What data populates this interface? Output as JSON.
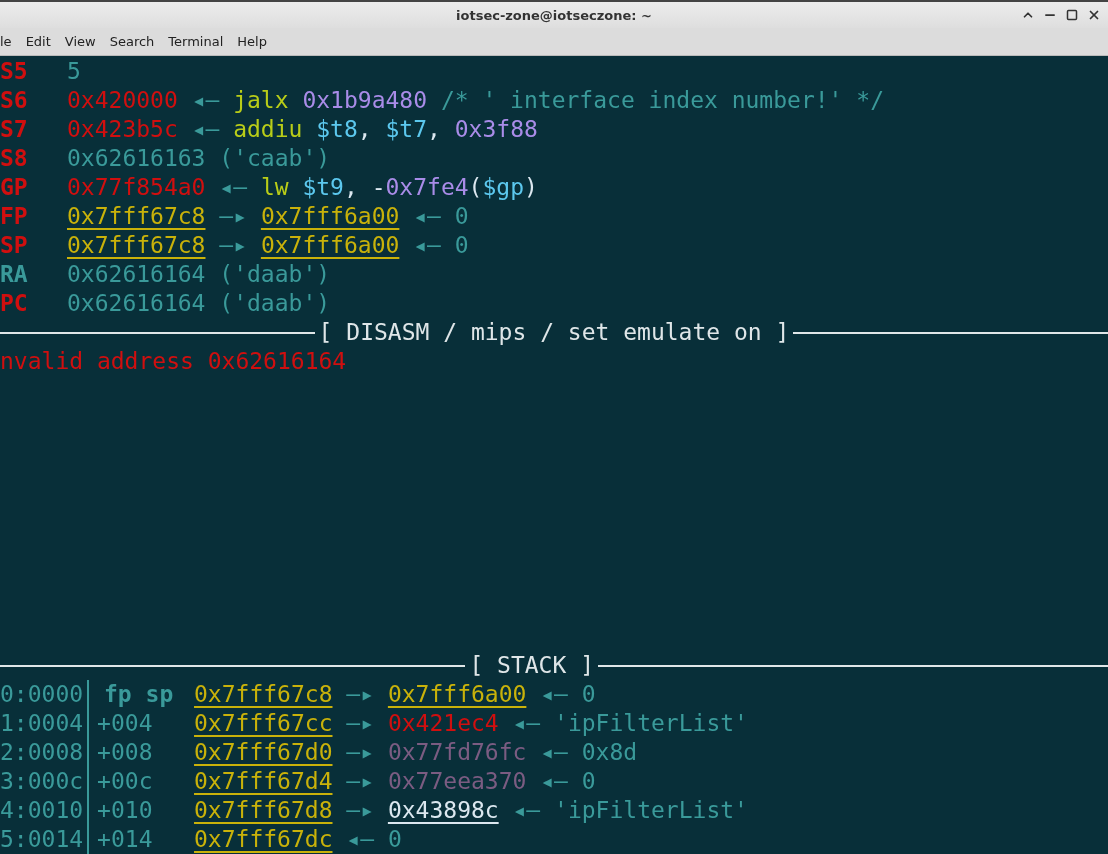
{
  "window": {
    "title": "iotsec-zone@iotseczone: ~"
  },
  "menu": [
    "le",
    "Edit",
    "View",
    "Search",
    "Terminal",
    "Help"
  ],
  "registers": [
    {
      "name": "S5",
      "changed": true,
      "parts": [
        {
          "text": "5",
          "kind": "num"
        }
      ]
    },
    {
      "name": "S6",
      "changed": true,
      "parts": [
        {
          "text": "0x420000",
          "kind": "code_addr"
        },
        {
          "text": " ◂— ",
          "kind": "arrow"
        },
        {
          "text": "jalx",
          "kind": "mnemonic"
        },
        {
          "text": "0x1b9a480",
          "kind": "imm"
        },
        {
          "text": " /* ' interface index number!' */",
          "kind": "comment"
        }
      ]
    },
    {
      "name": "S7",
      "changed": true,
      "parts": [
        {
          "text": "0x423b5c",
          "kind": "code_addr"
        },
        {
          "text": " ◂— ",
          "kind": "arrow"
        },
        {
          "text": "addiu",
          "kind": "mnemonic"
        },
        {
          "text": "$t8",
          "kind": "reg_op"
        },
        {
          "text": ", ",
          "kind": "plain"
        },
        {
          "text": "$t7",
          "kind": "reg_op"
        },
        {
          "text": ", ",
          "kind": "plain"
        },
        {
          "text": "0x3f88",
          "kind": "imm"
        }
      ]
    },
    {
      "name": "S8",
      "changed": true,
      "parts": [
        {
          "text": "0x62616163 ('caab')",
          "kind": "num"
        }
      ]
    },
    {
      "name": "GP",
      "changed": true,
      "parts": [
        {
          "text": "0x77f854a0",
          "kind": "code_addr"
        },
        {
          "text": " ◂— ",
          "kind": "arrow"
        },
        {
          "text": "lw",
          "kind": "mnemonic"
        },
        {
          "text": "$t9",
          "kind": "reg_op"
        },
        {
          "text": ", -",
          "kind": "plain"
        },
        {
          "text": "0x7fe4",
          "kind": "imm"
        },
        {
          "text": "(",
          "kind": "plain"
        },
        {
          "text": "$gp",
          "kind": "reg_op"
        },
        {
          "text": ")",
          "kind": "plain"
        }
      ]
    },
    {
      "name": "FP",
      "changed": true,
      "parts": [
        {
          "text": "0x7fff67c8",
          "kind": "stack_addr"
        },
        {
          "text": " —▸ ",
          "kind": "arrow"
        },
        {
          "text": "0x7fff6a00",
          "kind": "stack_addr"
        },
        {
          "text": " ◂— ",
          "kind": "arrow"
        },
        {
          "text": "0",
          "kind": "num"
        }
      ]
    },
    {
      "name": "SP",
      "changed": true,
      "parts": [
        {
          "text": "0x7fff67c8",
          "kind": "stack_addr"
        },
        {
          "text": " —▸ ",
          "kind": "arrow"
        },
        {
          "text": "0x7fff6a00",
          "kind": "stack_addr"
        },
        {
          "text": " ◂— ",
          "kind": "arrow"
        },
        {
          "text": "0",
          "kind": "num"
        }
      ]
    },
    {
      "name": "RA",
      "changed": false,
      "parts": [
        {
          "text": "0x62616164 ('daab')",
          "kind": "num"
        }
      ]
    },
    {
      "name": "PC",
      "changed": true,
      "parts": [
        {
          "text": "0x62616164 ('daab')",
          "kind": "num"
        }
      ]
    }
  ],
  "disasm": {
    "header": "[ DISASM / mips / set emulate on ]",
    "message": "nvalid address 0x62616164"
  },
  "stack": {
    "header": "[ STACK ]",
    "rows": [
      {
        "index": "0:0000",
        "offset": {
          "text": "fp sp",
          "kind": "label"
        },
        "parts": [
          {
            "text": "0x7fff67c8",
            "kind": "stack_addr"
          },
          {
            "text": " —▸ ",
            "kind": "arrow"
          },
          {
            "text": "0x7fff6a00",
            "kind": "stack_addr"
          },
          {
            "text": " ◂— ",
            "kind": "arrow"
          },
          {
            "text": "0",
            "kind": "num"
          }
        ]
      },
      {
        "index": "1:0004",
        "offset": {
          "text": "+004",
          "kind": "num"
        },
        "parts": [
          {
            "text": "0x7fff67cc",
            "kind": "stack_addr"
          },
          {
            "text": " —▸ ",
            "kind": "arrow"
          },
          {
            "text": "0x421ec4",
            "kind": "code_addr"
          },
          {
            "text": " ◂— ",
            "kind": "arrow"
          },
          {
            "text": "'ipFilterList'",
            "kind": "num"
          }
        ]
      },
      {
        "index": "2:0008",
        "offset": {
          "text": "+008",
          "kind": "num"
        },
        "parts": [
          {
            "text": "0x7fff67d0",
            "kind": "stack_addr"
          },
          {
            "text": " —▸ ",
            "kind": "arrow"
          },
          {
            "text": "0x77fd76fc",
            "kind": "heap_addr"
          },
          {
            "text": " ◂— ",
            "kind": "arrow"
          },
          {
            "text": "0x8d",
            "kind": "num"
          }
        ]
      },
      {
        "index": "3:000c",
        "offset": {
          "text": "+00c",
          "kind": "num"
        },
        "parts": [
          {
            "text": "0x7fff67d4",
            "kind": "stack_addr"
          },
          {
            "text": " —▸ ",
            "kind": "arrow"
          },
          {
            "text": "0x77eea370",
            "kind": "heap_addr"
          },
          {
            "text": " ◂— ",
            "kind": "arrow"
          },
          {
            "text": "0",
            "kind": "num"
          }
        ]
      },
      {
        "index": "4:0010",
        "offset": {
          "text": "+010",
          "kind": "num"
        },
        "parts": [
          {
            "text": "0x7fff67d8",
            "kind": "stack_addr"
          },
          {
            "text": " —▸ ",
            "kind": "arrow"
          },
          {
            "text": "0x43898c",
            "kind": "data_addr"
          },
          {
            "text": " ◂— ",
            "kind": "arrow"
          },
          {
            "text": "'ipFilterList'",
            "kind": "num"
          }
        ]
      },
      {
        "index": "5:0014",
        "offset": {
          "text": "+014",
          "kind": "num"
        },
        "parts": [
          {
            "text": "0x7fff67dc",
            "kind": "stack_addr"
          },
          {
            "text": " ◂— ",
            "kind": "arrow"
          },
          {
            "text": "0",
            "kind": "num"
          }
        ]
      }
    ]
  }
}
